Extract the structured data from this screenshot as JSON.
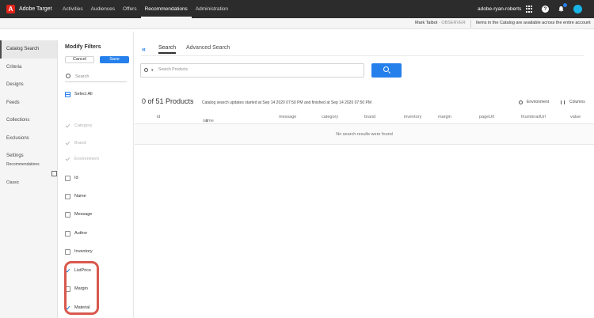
{
  "app": {
    "brand_letter": "A",
    "name": "Adobe Target"
  },
  "nav": [
    "Activities",
    "Audiences",
    "Offers",
    "Recommendations",
    "Administration"
  ],
  "active_nav": "Recommendations",
  "account": "adobe-ryan-roberts",
  "subheader": {
    "user": "Mark Talbot",
    "role": " - OBSERVER",
    "notice": "Items in the Catalog are available across the entire account"
  },
  "left_nav": [
    "Catalog Search",
    "Criteria",
    "Designs",
    "Feeds",
    "Collections",
    "Exclusions",
    "Settings"
  ],
  "left_nav_classic": "Recommendations Classic",
  "filters": {
    "title": "Modify Filters",
    "cancel": "Cancel",
    "save": "Save",
    "search_placeholder": "Search",
    "select_all": "Select All",
    "items": [
      {
        "label": "Category",
        "state": "disabled"
      },
      {
        "label": "Brand",
        "state": "disabled"
      },
      {
        "label": "Environment",
        "state": "disabled"
      },
      {
        "label": "Id",
        "state": "unchecked"
      },
      {
        "label": "Name",
        "state": "unchecked"
      },
      {
        "label": "Message",
        "state": "unchecked"
      },
      {
        "label": "Author",
        "state": "unchecked"
      },
      {
        "label": "Inventory",
        "state": "unchecked"
      },
      {
        "label": "ListPrice",
        "state": "checked"
      },
      {
        "label": "Margin",
        "state": "unchecked"
      },
      {
        "label": "Material",
        "state": "checked"
      }
    ]
  },
  "main": {
    "collapse_glyph": "«",
    "tabs": [
      "Search",
      "Advanced Search"
    ],
    "search_placeholder": "Search Products",
    "dropdown_glyph": "▾",
    "result_count": "0 of 51 Products",
    "sync_status": "Catalog search updates started at Sep 14 2020 07:50 PM and finished at Sep 14 2020 07:50 PM",
    "environment_label": "Environment",
    "columns_label": "Columns",
    "table_columns": [
      "id",
      "name",
      "message",
      "category",
      "brand",
      "inventory",
      "margin",
      "pageUrl",
      "thumbnailUrl",
      "value"
    ],
    "sort_glyph": "⬆",
    "empty_message": "No search results were found"
  },
  "colors": {
    "accent": "#2680eb",
    "highlight": "#d9584d",
    "topbar": "#2c2c2c"
  }
}
